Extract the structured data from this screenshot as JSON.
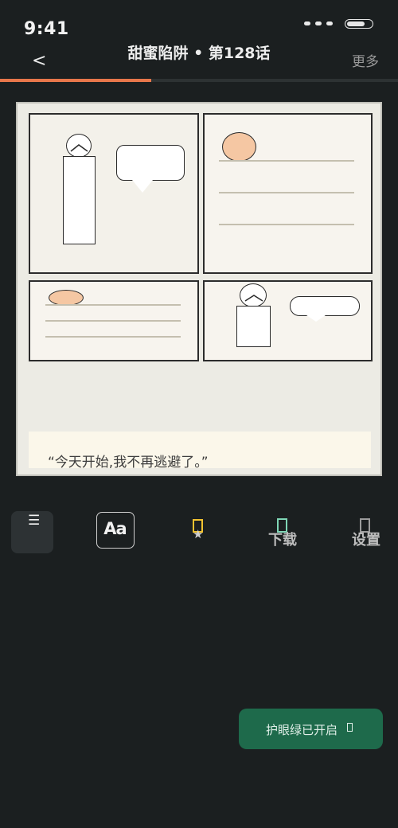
{
  "status_bar": {
    "time": "9:41"
  },
  "header": {
    "back_label": "<",
    "title": "甜蜜陷阱 • 第128话",
    "more_label": "更多"
  },
  "reading_progress": 0.38,
  "page": {
    "caption": "“今天开始,我不再逃避了。”"
  },
  "toolbar": {
    "list_icon": "list-icon",
    "font_label": "Aa",
    "bookmark_icon": "bookmark-icon",
    "star_glyph": "★",
    "download_label": "下载",
    "settings_label": "设置"
  },
  "toast": {
    "text": "护眼绿已开启"
  },
  "colors": {
    "background": "#1b1f20",
    "accent_progress": "#e8774b",
    "toast": "#1e6a4b",
    "bookmark": "#f2c230",
    "download": "#7fd6b6"
  }
}
